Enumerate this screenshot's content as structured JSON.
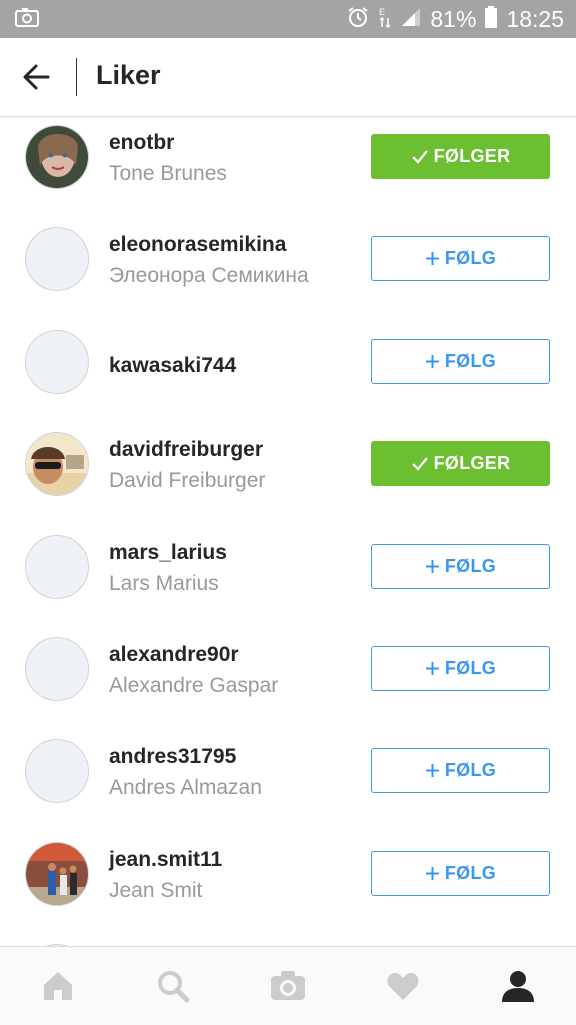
{
  "status_bar": {
    "battery": "81%",
    "time": "18:25"
  },
  "header": {
    "title": "Liker"
  },
  "follow_labels": {
    "follow": "FØLG",
    "following": "FØLGER"
  },
  "users": [
    {
      "username": "enotbr",
      "full_name": "Tone Brunes",
      "following": true,
      "avatar": "photo"
    },
    {
      "username": "eleonorasemikina",
      "full_name": "Элеонора Семикина",
      "following": false,
      "avatar": "placeholder"
    },
    {
      "username": "kawasaki744",
      "full_name": "",
      "following": false,
      "avatar": "placeholder"
    },
    {
      "username": "davidfreiburger",
      "full_name": "David Freiburger",
      "following": true,
      "avatar": "photo"
    },
    {
      "username": "mars_larius",
      "full_name": "Lars Marius",
      "following": false,
      "avatar": "placeholder"
    },
    {
      "username": "alexandre90r",
      "full_name": "Alexandre Gaspar",
      "following": false,
      "avatar": "placeholder"
    },
    {
      "username": "andres31795",
      "full_name": "Andres Almazan",
      "following": false,
      "avatar": "placeholder"
    },
    {
      "username": "jean.smit11",
      "full_name": "Jean Smit",
      "following": false,
      "avatar": "photo"
    }
  ],
  "bottom_nav": [
    "home-icon",
    "search-icon",
    "camera-icon",
    "heart-icon",
    "profile-icon"
  ],
  "colors": {
    "follow_blue": "#3897f0",
    "following_green": "#6bbf30",
    "status_bar": "#a4a4a4"
  }
}
